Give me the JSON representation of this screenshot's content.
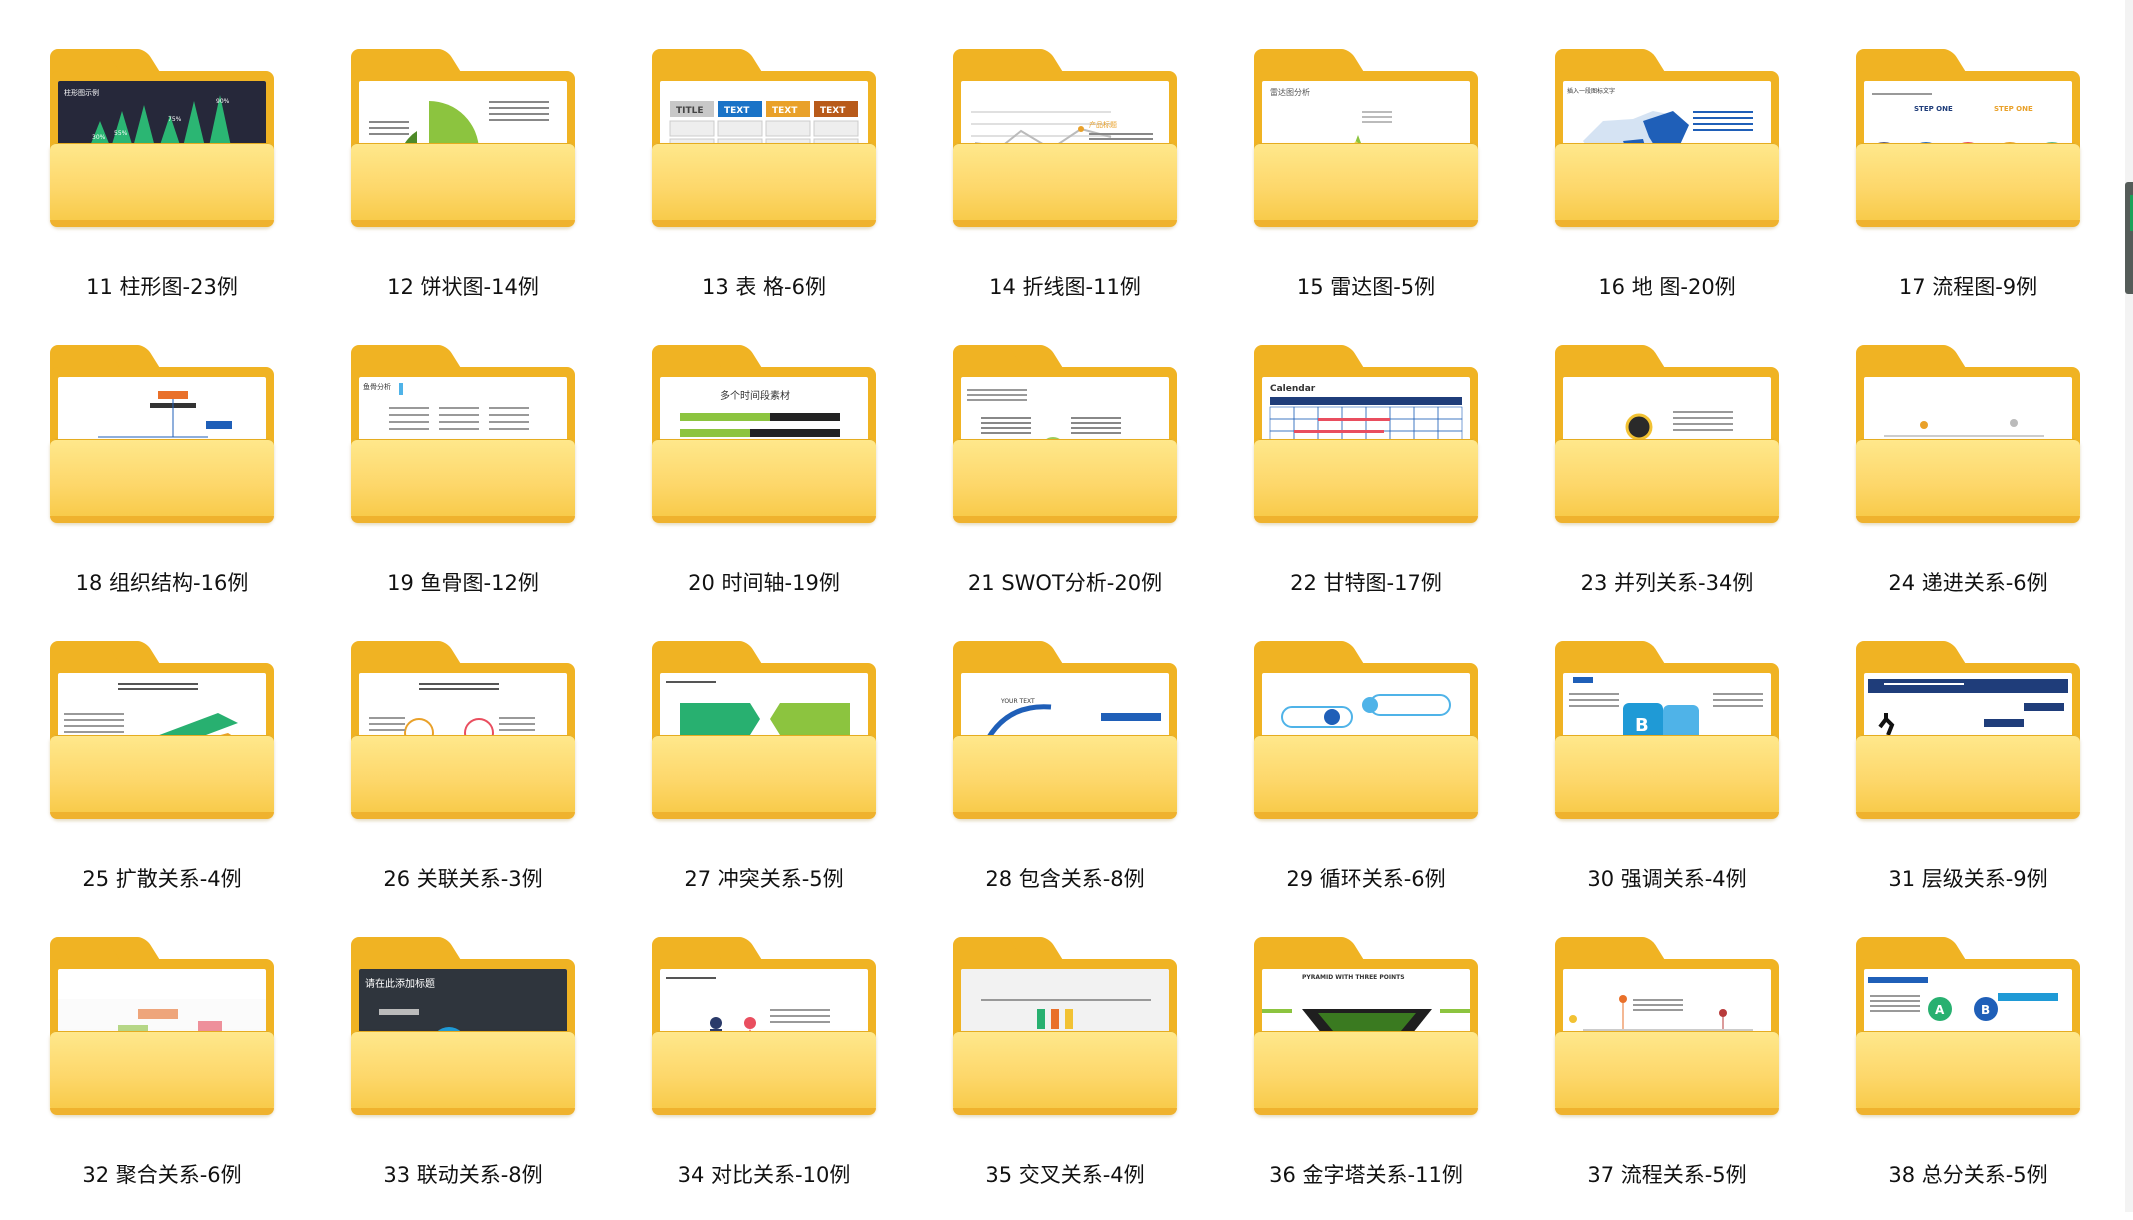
{
  "folders": [
    {
      "label": "11 柱形图-23例",
      "preview": "bars",
      "thumb_text": "柱形图示例"
    },
    {
      "label": "12 饼状图-14例",
      "preview": "pie"
    },
    {
      "label": "13 表 格-6例",
      "preview": "table",
      "thumb_text": [
        "TITLE",
        "TEXT",
        "TEXT",
        "TEXT"
      ]
    },
    {
      "label": "14 折线图-11例",
      "preview": "line",
      "thumb_text": "产品标题"
    },
    {
      "label": "15 雷达图-5例",
      "preview": "radar",
      "thumb_text": "雷达图分析"
    },
    {
      "label": "16 地 图-20例",
      "preview": "map",
      "thumb_text": "插入一段图标文字"
    },
    {
      "label": "17 流程图-9例",
      "preview": "rings",
      "thumb_text": [
        "STEP ONE",
        "STEP ONE"
      ]
    },
    {
      "label": "18 组织结构-16例",
      "preview": "org"
    },
    {
      "label": "19 鱼骨图-12例",
      "preview": "fish",
      "thumb_text": "鱼骨分析"
    },
    {
      "label": "20 时间轴-19例",
      "preview": "timeline",
      "thumb_text": "多个时间段素材"
    },
    {
      "label": "21 SWOT分析-20例",
      "preview": "swot"
    },
    {
      "label": "22 甘特图-17例",
      "preview": "gantt",
      "thumb_text": "Calendar"
    },
    {
      "label": "23 并列关系-34例",
      "preview": "parallel"
    },
    {
      "label": "24 递进关系-6例",
      "preview": "progress"
    },
    {
      "label": "25 扩散关系-4例",
      "preview": "spread"
    },
    {
      "label": "26 关联关系-3例",
      "preview": "relate"
    },
    {
      "label": "27 冲突关系-5例",
      "preview": "conflict"
    },
    {
      "label": "28 包含关系-8例",
      "preview": "contain",
      "thumb_text": "YOUR TEXT"
    },
    {
      "label": "29 循环关系-6例",
      "preview": "cycle"
    },
    {
      "label": "30 强调关系-4例",
      "preview": "emphasis"
    },
    {
      "label": "31 层级关系-9例",
      "preview": "hierarchy"
    },
    {
      "label": "32 聚合关系-6例",
      "preview": "aggregate"
    },
    {
      "label": "33 联动关系-8例",
      "preview": "linkage",
      "thumb_text": "请在此添加标题"
    },
    {
      "label": "34 对比关系-10例",
      "preview": "compare"
    },
    {
      "label": "35 交叉关系-4例",
      "preview": "cross"
    },
    {
      "label": "36 金字塔关系-11例",
      "preview": "pyramid",
      "thumb_text": "PYRAMID WITH THREE POINTS"
    },
    {
      "label": "37 流程关系-5例",
      "preview": "flow"
    },
    {
      "label": "38 总分关系-5例",
      "preview": "total"
    }
  ],
  "colors": {
    "folder_back": "#f0b323",
    "folder_front": "#fdd76a"
  }
}
